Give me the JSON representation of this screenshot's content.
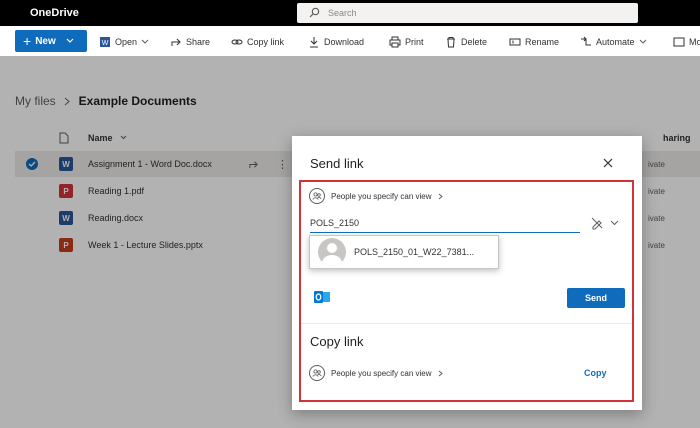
{
  "app": {
    "title": "OneDrive"
  },
  "search": {
    "placeholder": "Search"
  },
  "toolbar": {
    "new_label": "New",
    "items": [
      {
        "label": "Open"
      },
      {
        "label": "Share"
      },
      {
        "label": "Copy link"
      },
      {
        "label": "Download"
      },
      {
        "label": "Print"
      },
      {
        "label": "Delete"
      },
      {
        "label": "Rename"
      },
      {
        "label": "Automate"
      },
      {
        "label": "Mo"
      }
    ]
  },
  "breadcrumb": {
    "parent": "My files",
    "current": "Example Documents"
  },
  "list": {
    "name_header": "Name",
    "sharing_header": "haring",
    "files": [
      {
        "name": "Assignment 1 - Word Doc.docx",
        "type": "word",
        "sharing": "ivate"
      },
      {
        "name": "Reading 1.pdf",
        "type": "pdf",
        "sharing": "ivate"
      },
      {
        "name": "Reading.docx",
        "type": "word",
        "sharing": "ivate"
      },
      {
        "name": "Week 1 - Lecture Slides.pptx",
        "type": "ppt",
        "sharing": "ivate"
      }
    ]
  },
  "dialog": {
    "title": "Send link",
    "permission": "People you specify can view",
    "recipient_value": "POLS_2150",
    "suggestion": "POLS_2150_01_W22_7381...",
    "send_label": "Send",
    "copy_title": "Copy link",
    "copy_permission": "People you specify can view",
    "copy_label": "Copy"
  },
  "colors": {
    "accent": "#0f6cbd",
    "highlight": "#d13438",
    "topbar": "#000000"
  }
}
